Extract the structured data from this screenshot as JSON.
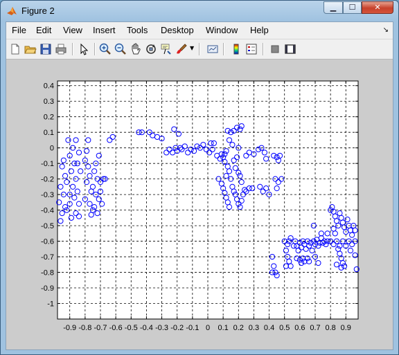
{
  "window": {
    "title": "Figure 2"
  },
  "menu": [
    "File",
    "Edit",
    "View",
    "Insert",
    "Tools",
    "Desktop",
    "Window",
    "Help"
  ],
  "toolbar_icons": [
    "new-figure-icon",
    "open-file-icon",
    "save-icon",
    "print-icon",
    "pointer-icon",
    "zoom-in-icon",
    "zoom-out-icon",
    "pan-hand-icon",
    "rotate-3d-icon",
    "data-cursor-icon",
    "brush-icon",
    "link-plot-icon",
    "colorbar-icon",
    "legend-icon",
    "hide-plot-tools-icon",
    "show-plot-tools-icon"
  ],
  "colors": {
    "marker": "#0000ff",
    "axes_bg": "#ffffff",
    "figure_bg": "#cccccc"
  },
  "chart_data": {
    "type": "scatter",
    "marker": "circle",
    "xlim": [
      -0.98,
      0.98
    ],
    "ylim": [
      -1.1,
      0.43
    ],
    "xticks": [
      -0.9,
      -0.8,
      -0.7,
      -0.6,
      -0.5,
      -0.4,
      -0.3,
      -0.2,
      -0.1,
      0,
      0.1,
      0.2,
      0.3,
      0.4,
      0.5,
      0.6,
      0.7,
      0.8,
      0.9
    ],
    "yticks": [
      0.4,
      0.3,
      0.2,
      0.1,
      0,
      -0.1,
      -0.2,
      -0.3,
      -0.4,
      -0.5,
      -0.6,
      -0.7,
      -0.8,
      -0.9,
      -1
    ],
    "xtick_labels": [
      "-0.9",
      "-0.8",
      "-0.7",
      "-0.6",
      "-0.5",
      "-0.4",
      "-0.3",
      "-0.2",
      "-0.1",
      "0",
      "0.1",
      "0.2",
      "0.3",
      "0.4",
      "0.5",
      "0.6",
      "0.7",
      "0.8",
      "0.9"
    ],
    "ytick_labels": [
      "0.4",
      "0.3",
      "0.2",
      "0.1",
      "0",
      "-0.1",
      "-0.2",
      "-0.3",
      "-0.4",
      "-0.5",
      "-0.6",
      "-0.7",
      "-0.8",
      "-0.9",
      "-1"
    ],
    "grid": "dashed",
    "points": [
      [
        -0.95,
        -0.12
      ],
      [
        -0.93,
        -0.18
      ],
      [
        -0.96,
        -0.25
      ],
      [
        -0.94,
        -0.3
      ],
      [
        -0.97,
        -0.35
      ],
      [
        -0.93,
        -0.38
      ],
      [
        -0.95,
        -0.42
      ],
      [
        -0.96,
        -0.47
      ],
      [
        -0.92,
        -0.4
      ],
      [
        -0.9,
        -0.36
      ],
      [
        -0.91,
        0.05
      ],
      [
        -0.88,
        0.0
      ],
      [
        -0.9,
        -0.05
      ],
      [
        -0.87,
        -0.1
      ],
      [
        -0.89,
        -0.15
      ],
      [
        -0.86,
        -0.2
      ],
      [
        -0.88,
        -0.25
      ],
      [
        -0.85,
        -0.28
      ],
      [
        -0.87,
        -0.32
      ],
      [
        -0.84,
        -0.36
      ],
      [
        -0.86,
        0.05
      ],
      [
        -0.84,
        -0.03
      ],
      [
        -0.85,
        -0.1
      ],
      [
        -0.83,
        -0.15
      ],
      [
        -0.86,
        -0.42
      ],
      [
        -0.89,
        -0.45
      ],
      [
        -0.84,
        -0.44
      ],
      [
        -0.9,
        -0.3
      ],
      [
        -0.92,
        -0.22
      ],
      [
        -0.94,
        -0.08
      ],
      [
        -0.78,
        0.05
      ],
      [
        -0.79,
        -0.02
      ],
      [
        -0.8,
        -0.08
      ],
      [
        -0.78,
        -0.12
      ],
      [
        -0.77,
        -0.18
      ],
      [
        -0.79,
        -0.22
      ],
      [
        -0.76,
        -0.28
      ],
      [
        -0.8,
        -0.33
      ],
      [
        -0.77,
        -0.36
      ],
      [
        -0.75,
        -0.4
      ],
      [
        -0.73,
        -0.1
      ],
      [
        -0.74,
        -0.15
      ],
      [
        -0.72,
        -0.2
      ],
      [
        -0.75,
        -0.25
      ],
      [
        -0.73,
        -0.3
      ],
      [
        -0.71,
        -0.33
      ],
      [
        -0.74,
        -0.38
      ],
      [
        -0.72,
        -0.42
      ],
      [
        -0.76,
        -0.43
      ],
      [
        -0.7,
        -0.22
      ],
      [
        -0.68,
        -0.2
      ],
      [
        -0.7,
        -0.28
      ],
      [
        -0.69,
        -0.36
      ],
      [
        -0.71,
        -0.05
      ],
      [
        -0.64,
        0.05
      ],
      [
        -0.62,
        0.07
      ],
      [
        -0.67,
        -0.2
      ],
      [
        -0.45,
        0.1
      ],
      [
        -0.43,
        0.1
      ],
      [
        -0.38,
        0.1
      ],
      [
        -0.36,
        0.08
      ],
      [
        -0.33,
        0.07
      ],
      [
        -0.3,
        0.06
      ],
      [
        -0.27,
        -0.03
      ],
      [
        -0.25,
        -0.01
      ],
      [
        -0.23,
        -0.03
      ],
      [
        -0.21,
        0.0
      ],
      [
        -0.2,
        -0.02
      ],
      [
        -0.18,
        0.0
      ],
      [
        -0.17,
        -0.01
      ],
      [
        -0.15,
        0.01
      ],
      [
        -0.13,
        -0.03
      ],
      [
        -0.11,
        -0.01
      ],
      [
        -0.09,
        -0.02
      ],
      [
        -0.07,
        0.01
      ],
      [
        -0.05,
        0.0
      ],
      [
        -0.03,
        0.02
      ],
      [
        -0.01,
        -0.01
      ],
      [
        0.02,
        0.03
      ],
      [
        0.01,
        -0.03
      ],
      [
        0.04,
        0.03
      ],
      [
        0.03,
        -0.01
      ],
      [
        -0.22,
        0.12
      ],
      [
        -0.19,
        0.09
      ],
      [
        0.06,
        -0.05
      ],
      [
        0.08,
        -0.07
      ],
      [
        0.09,
        -0.04
      ],
      [
        0.1,
        -0.06
      ],
      [
        0.11,
        -0.04
      ],
      [
        0.12,
        -0.02
      ],
      [
        0.13,
        0.11
      ],
      [
        0.15,
        0.1
      ],
      [
        0.17,
        0.11
      ],
      [
        0.19,
        0.13
      ],
      [
        0.21,
        0.12
      ],
      [
        0.22,
        0.14
      ],
      [
        0.14,
        0.05
      ],
      [
        0.16,
        0.02
      ],
      [
        0.2,
        0.0
      ],
      [
        0.07,
        -0.2
      ],
      [
        0.09,
        -0.23
      ],
      [
        0.1,
        -0.26
      ],
      [
        0.11,
        -0.29
      ],
      [
        0.12,
        -0.32
      ],
      [
        0.13,
        -0.35
      ],
      [
        0.14,
        -0.38
      ],
      [
        0.15,
        -0.2
      ],
      [
        0.16,
        -0.25
      ],
      [
        0.17,
        -0.28
      ],
      [
        0.18,
        -0.3
      ],
      [
        0.19,
        -0.33
      ],
      [
        0.2,
        -0.36
      ],
      [
        0.21,
        -0.38
      ],
      [
        0.22,
        -0.34
      ],
      [
        0.23,
        -0.3
      ],
      [
        0.24,
        -0.27
      ],
      [
        0.25,
        -0.28
      ],
      [
        0.27,
        -0.26
      ],
      [
        0.29,
        -0.26
      ],
      [
        0.11,
        -0.09
      ],
      [
        0.13,
        -0.12
      ],
      [
        0.14,
        -0.15
      ],
      [
        0.12,
        -0.18
      ],
      [
        0.17,
        -0.08
      ],
      [
        0.19,
        -0.06
      ],
      [
        0.18,
        -0.13
      ],
      [
        0.2,
        -0.16
      ],
      [
        0.21,
        -0.18
      ],
      [
        0.22,
        -0.22
      ],
      [
        0.25,
        -0.05
      ],
      [
        0.27,
        -0.03
      ],
      [
        0.3,
        -0.04
      ],
      [
        0.33,
        -0.01
      ],
      [
        0.35,
        0.0
      ],
      [
        0.37,
        -0.03
      ],
      [
        0.38,
        -0.07
      ],
      [
        0.34,
        -0.25
      ],
      [
        0.36,
        -0.28
      ],
      [
        0.38,
        -0.26
      ],
      [
        0.4,
        -0.3
      ],
      [
        0.43,
        -0.05
      ],
      [
        0.45,
        -0.06
      ],
      [
        0.46,
        -0.08
      ],
      [
        0.47,
        -0.05
      ],
      [
        0.44,
        -0.2
      ],
      [
        0.46,
        -0.22
      ],
      [
        0.45,
        -0.26
      ],
      [
        0.48,
        -0.2
      ],
      [
        0.42,
        -0.7
      ],
      [
        0.43,
        -0.76
      ],
      [
        0.44,
        -0.8
      ],
      [
        0.45,
        -0.82
      ],
      [
        0.42,
        -0.8
      ],
      [
        0.5,
        -0.6
      ],
      [
        0.52,
        -0.62
      ],
      [
        0.53,
        -0.6
      ],
      [
        0.54,
        -0.58
      ],
      [
        0.51,
        -0.66
      ],
      [
        0.52,
        -0.7
      ],
      [
        0.53,
        -0.73
      ],
      [
        0.54,
        -0.76
      ],
      [
        0.51,
        -0.76
      ],
      [
        0.56,
        -0.63
      ],
      [
        0.57,
        -0.6
      ],
      [
        0.58,
        -0.63
      ],
      [
        0.59,
        -0.66
      ],
      [
        0.6,
        -0.61
      ],
      [
        0.61,
        -0.64
      ],
      [
        0.62,
        -0.6
      ],
      [
        0.63,
        -0.62
      ],
      [
        0.64,
        -0.65
      ],
      [
        0.65,
        -0.6
      ],
      [
        0.66,
        -0.63
      ],
      [
        0.67,
        -0.61
      ],
      [
        0.68,
        -0.66
      ],
      [
        0.69,
        -0.6
      ],
      [
        0.7,
        -0.62
      ],
      [
        0.71,
        -0.59
      ],
      [
        0.72,
        -0.63
      ],
      [
        0.73,
        -0.61
      ],
      [
        0.74,
        -0.58
      ],
      [
        0.75,
        -0.61
      ],
      [
        0.76,
        -0.6
      ],
      [
        0.77,
        -0.62
      ],
      [
        0.78,
        -0.6
      ],
      [
        0.58,
        -0.71
      ],
      [
        0.6,
        -0.72
      ],
      [
        0.61,
        -0.74
      ],
      [
        0.62,
        -0.71
      ],
      [
        0.63,
        -0.73
      ],
      [
        0.65,
        -0.71
      ],
      [
        0.66,
        -0.73
      ],
      [
        0.7,
        -0.7
      ],
      [
        0.72,
        -0.74
      ],
      [
        0.69,
        -0.5
      ],
      [
        0.74,
        -0.55
      ],
      [
        0.78,
        -0.55
      ],
      [
        0.8,
        -0.4
      ],
      [
        0.81,
        -0.38
      ],
      [
        0.82,
        -0.41
      ],
      [
        0.83,
        -0.44
      ],
      [
        0.84,
        -0.47
      ],
      [
        0.85,
        -0.5
      ],
      [
        0.86,
        -0.42
      ],
      [
        0.87,
        -0.45
      ],
      [
        0.88,
        -0.48
      ],
      [
        0.89,
        -0.51
      ],
      [
        0.9,
        -0.54
      ],
      [
        0.91,
        -0.46
      ],
      [
        0.92,
        -0.5
      ],
      [
        0.93,
        -0.53
      ],
      [
        0.94,
        -0.56
      ],
      [
        0.95,
        -0.5
      ],
      [
        0.96,
        -0.53
      ],
      [
        0.83,
        -0.55
      ],
      [
        0.82,
        -0.52
      ],
      [
        0.8,
        -0.6
      ],
      [
        0.82,
        -0.62
      ],
      [
        0.84,
        -0.6
      ],
      [
        0.86,
        -0.63
      ],
      [
        0.88,
        -0.6
      ],
      [
        0.9,
        -0.63
      ],
      [
        0.92,
        -0.6
      ],
      [
        0.94,
        -0.62
      ],
      [
        0.96,
        -0.6
      ],
      [
        0.85,
        -0.65
      ],
      [
        0.86,
        -0.68
      ],
      [
        0.87,
        -0.71
      ],
      [
        0.88,
        -0.74
      ],
      [
        0.89,
        -0.76
      ],
      [
        0.87,
        -0.77
      ],
      [
        0.84,
        -0.75
      ],
      [
        0.96,
        -0.69
      ],
      [
        0.97,
        -0.78
      ],
      [
        0.93,
        -0.66
      ]
    ]
  }
}
